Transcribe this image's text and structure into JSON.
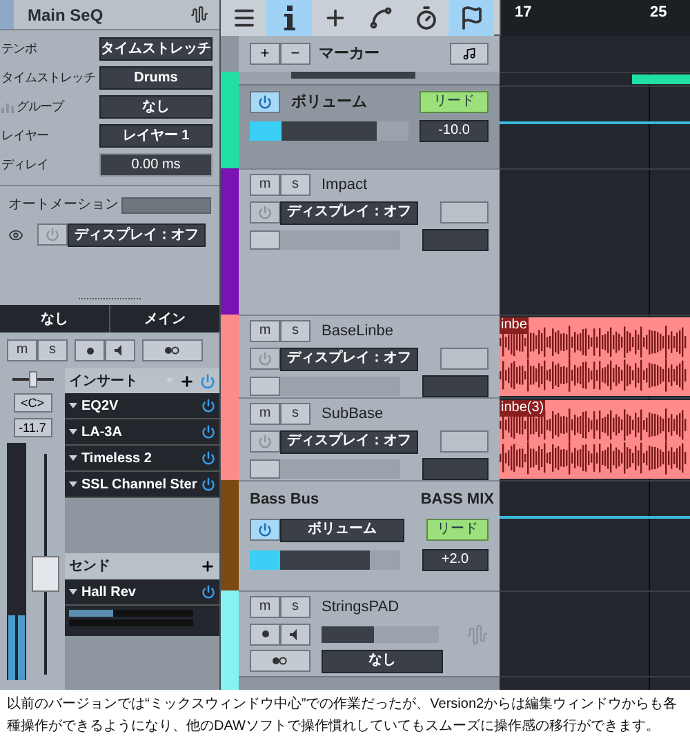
{
  "inspector": {
    "title": "Main SeQ",
    "params": [
      {
        "kind": "param",
        "label": "テンポ",
        "value": "タイムストレッチ"
      },
      {
        "kind": "param",
        "label": "タイムストレッチ",
        "value": "Drums"
      },
      {
        "kind": "group",
        "label": "グループ",
        "value": "なし"
      },
      {
        "kind": "param",
        "label": "レイヤー",
        "value": "レイヤー 1"
      },
      {
        "kind": "field",
        "label": "ディレイ",
        "value": "0.00 ms"
      }
    ],
    "automation": {
      "label": "オートメーション",
      "power_on": false,
      "display": "ディスプレイ：オフ"
    }
  },
  "routing": {
    "input": "なし",
    "output": "メイン"
  },
  "channel_buttons": {
    "mute": "m",
    "solo": "s"
  },
  "channel": {
    "pan": {
      "level": 0.5
    },
    "pan_value": "<C>",
    "volume": "-11.7",
    "fader": {
      "level": 0.45
    }
  },
  "inserts": {
    "title": "インサート",
    "on": true,
    "items": [
      {
        "name": "EQ2V",
        "on": true
      },
      {
        "name": "LA-3A",
        "on": true
      },
      {
        "name": "Timeless 2",
        "on": true
      },
      {
        "name": "SSL Channel Ster",
        "on": true
      }
    ]
  },
  "sends": {
    "title": "センド",
    "items": [
      {
        "name": "Hall Rev",
        "on": true,
        "level": 0.35,
        "pan": {
          "level": 0
        }
      }
    ]
  },
  "toolbar": [
    {
      "kind": "menu",
      "selected": false
    },
    {
      "kind": "info",
      "selected": true
    },
    {
      "kind": "add",
      "selected": false
    },
    {
      "kind": "automation",
      "selected": false
    },
    {
      "kind": "clock",
      "selected": false
    },
    {
      "kind": "flag",
      "selected": true
    }
  ],
  "marker_bar": {
    "add": "+",
    "remove": "−",
    "title": "マーカー"
  },
  "ruler": [
    "17",
    "25"
  ],
  "tracks": [
    {
      "kind": "cut",
      "color": "#1fe0a2"
    },
    {
      "kind": "automation",
      "color": "#1fe0a2",
      "power_on": true,
      "label": "ボリューム",
      "tag": "リード",
      "level": 0.2,
      "value": "-10.0"
    },
    {
      "kind": "track",
      "color": "#7a12b4",
      "mute": "m",
      "solo": "s",
      "name": "Impact",
      "power_on": false,
      "display": "ディスプレイ：オフ",
      "level": 0
    },
    {
      "kind": "spacer",
      "color": "#7a12b4"
    },
    {
      "kind": "track",
      "color": "#ff8a8a",
      "mute": "m",
      "solo": "s",
      "name": "BaseLinbe",
      "power_on": false,
      "display": "ディスプレイ：オフ",
      "level": 0,
      "clip": "inbe"
    },
    {
      "kind": "track",
      "color": "#ff8a8a",
      "mute": "m",
      "solo": "s",
      "name": "SubBase",
      "power_on": false,
      "display": "ディスプレイ：オフ",
      "level": 0,
      "clip": "inbe(3)"
    },
    {
      "kind": "bus",
      "color": "#7a4a12",
      "name": "Bass Bus",
      "subtitle": "BASS MIX",
      "power_on": true,
      "label": "ボリューム",
      "tag": "リード",
      "level": 0.2,
      "value": "+2.0"
    },
    {
      "kind": "compact",
      "color": "#86f2f2",
      "mute": "m",
      "solo": "s",
      "name": "StringsPAD",
      "level": 0.45,
      "output": "なし"
    },
    {
      "kind": "tail",
      "color": "#86f2f2"
    }
  ],
  "caption": "以前のバージョンでは“ミックスウィンドウ中心”での作業だったが、Version2からは編集ウィンドウからも各種操作ができるようになり、他のDAWソフトで操作慣れしていてもスムーズに操作感の移行ができます。"
}
